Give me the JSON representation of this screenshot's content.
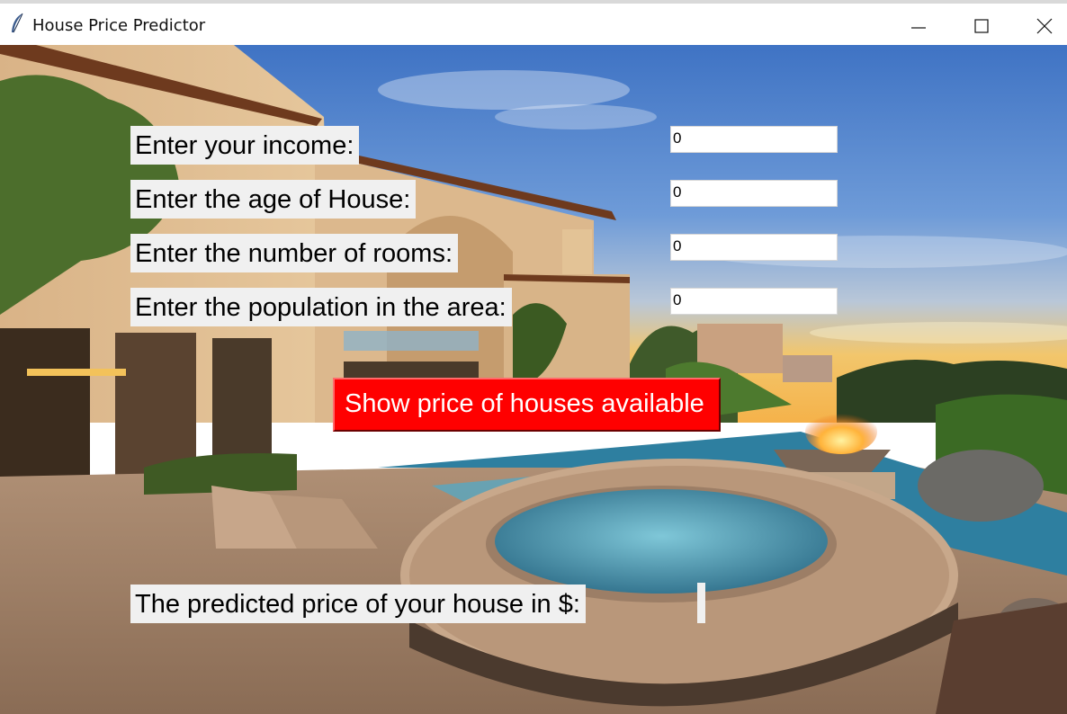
{
  "window": {
    "title": "House Price Predictor",
    "controls": [
      "minimize",
      "maximize",
      "close"
    ]
  },
  "form": {
    "income_label": "Enter your income:",
    "age_label": "Enter the age of House:",
    "rooms_label": "Enter the number of rooms:",
    "population_label": "Enter the population in the area:",
    "income_value": "0",
    "age_value": "0",
    "rooms_value": "0",
    "population_value": "0"
  },
  "actions": {
    "show_price_label": "Show price of houses available"
  },
  "result": {
    "label": "The predicted price of your house in $:",
    "value": ""
  },
  "colors": {
    "button_bg": "#ff0000",
    "button_text": "#ffffff",
    "label_bg": "#f0f0f0"
  }
}
